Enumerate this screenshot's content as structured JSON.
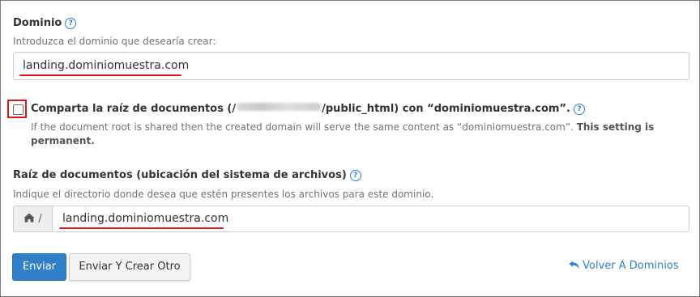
{
  "domain_field": {
    "label": "Dominio",
    "help_icon": "question-circle-icon",
    "hint": "Introduzca el dominio que desearía crear:",
    "value": "landing.dominiomuestra.com"
  },
  "share_root": {
    "checked": false,
    "label_prefix": "Comparta la raíz de documentos (/",
    "label_suffix": "/public_html) con “dominiomuestra.com”.",
    "help_icon": "question-circle-icon",
    "note": "If the document root is shared then the created domain will serve the same content as “dominiomuestra.com”.",
    "note_bold_1": "This setting is",
    "note_bold_2": "permanent."
  },
  "docroot_field": {
    "label": "Raíz de documentos (ubicación del sistema de archivos)",
    "help_icon": "question-circle-icon",
    "hint": "Indique el directorio donde desea que estén presentes los archivos para este dominio.",
    "addon_icon": "home-icon",
    "addon_text": "/",
    "value": "landing.dominiomuestra.com"
  },
  "actions": {
    "submit_label": "Enviar",
    "submit_another_label": "Enviar Y Crear Otro",
    "back_icon": "undo-arrow-icon",
    "back_label": "Volver A Dominios"
  },
  "colors": {
    "primary": "#2f80c9",
    "highlight_red": "#e0141e"
  }
}
